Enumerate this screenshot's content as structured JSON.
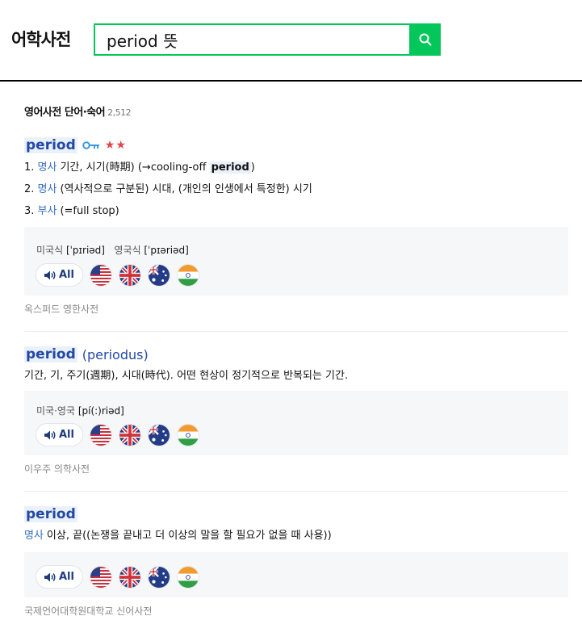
{
  "app": {
    "title": "어학사전"
  },
  "search": {
    "value": "period 뜻"
  },
  "section": {
    "title": "영어사전 단어·숙어",
    "count": "2,512"
  },
  "entries": [
    {
      "word": "period",
      "stars": "★★",
      "senses": [
        {
          "num": "1.",
          "pos": "명사",
          "text": "기간, 시기(時期) (→cooling-off ",
          "highlight": "period",
          "after": ")"
        },
        {
          "num": "2.",
          "pos": "명사",
          "text": "(역사적으로 구분된) 시대, (개인의 인생에서 특정한) 시기"
        },
        {
          "num": "3.",
          "pos": "부사",
          "text": "(=full stop)"
        }
      ],
      "pron_us_label": "미국식",
      "pron_us": "[ˈpɪriəd]",
      "pron_uk_label": "영국식",
      "pron_uk": "[ˈpɪəriəd]",
      "all_label": "All",
      "source": "옥스퍼드 영한사전"
    },
    {
      "word": "period",
      "origin": "(periodus)",
      "definition": "기간, 기, 주기(週期), 시대(時代). 어떤 현상이 정기적으로 반복되는 기간.",
      "pron_label": "미국·영국",
      "pron": "[pí(:)riəd]",
      "all_label": "All",
      "source": "이우주 의학사전"
    },
    {
      "word": "period",
      "pos": "명사",
      "definition": "이상, 끝((논쟁을 끝내고 더 이상의 말을 할 필요가 없을 때 사용))",
      "all_label": "All",
      "source": "국제언어대학원대학교 신어사전"
    }
  ],
  "icons": {
    "search": "search-icon",
    "key": "key-icon",
    "speaker": "speaker-icon"
  },
  "colors": {
    "brand": "#03c75a",
    "word": "#2349a5",
    "pos": "#3a6fbf",
    "star": "#e0474c"
  }
}
